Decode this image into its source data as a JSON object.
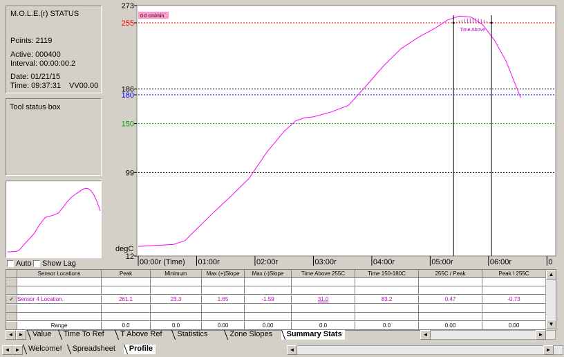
{
  "status": {
    "title": "M.O.L.E.(r) STATUS",
    "points": "Points: 2119",
    "active": "Active: 000400",
    "interval": "Interval: 00:00:00.2",
    "date": "Date: 01/21/15",
    "time": "Time: 09:37:31",
    "version": "VV00.00"
  },
  "tool_status": "Tool status box",
  "controls": {
    "auto_label": "Auto",
    "show_lag_label": "Show Lag"
  },
  "chart_data": {
    "type": "line",
    "badge": "0.0 cm/min",
    "ylabel": "degC",
    "ylim": [
      12,
      273
    ],
    "xlim_min": [
      0,
      6.6
    ],
    "y_ticks": [
      {
        "value": 273,
        "color": "#000000",
        "label": "273"
      },
      {
        "value": 255,
        "color": "#ff0000",
        "label": "255"
      },
      {
        "value": 186,
        "color": "#000000",
        "label": "186"
      },
      {
        "value": 180,
        "color": "#0000ff",
        "label": "180"
      },
      {
        "value": 150,
        "color": "#009900",
        "label": "150"
      },
      {
        "value": 99,
        "color": "#000000",
        "label": "99"
      },
      {
        "value": 12,
        "color": "#000000",
        "label": "12"
      }
    ],
    "ref_lines": [
      {
        "value": 255,
        "color": "#ff0000"
      },
      {
        "value": 186,
        "color": "#000000"
      },
      {
        "value": 180,
        "color": "#0000ff"
      },
      {
        "value": 150,
        "color": "#009900"
      },
      {
        "value": 99,
        "color": "#000000"
      }
    ],
    "x_ticks": [
      {
        "value": 0,
        "label": "00:00r (Time)"
      },
      {
        "value": 1,
        "label": "01:00r"
      },
      {
        "value": 2,
        "label": "02:00r"
      },
      {
        "value": 3,
        "label": "03:00r"
      },
      {
        "value": 4,
        "label": "04:00r"
      },
      {
        "value": 5,
        "label": "05:00r"
      },
      {
        "value": 6,
        "label": "06:00r"
      },
      {
        "value": 7,
        "label": "0"
      }
    ],
    "series": [
      {
        "color": "#ff00ff",
        "x": [
          0,
          0.3,
          0.6,
          0.8,
          1.0,
          1.3,
          1.6,
          1.9,
          2.2,
          2.5,
          2.7,
          2.85,
          3.0,
          3.3,
          3.6,
          3.9,
          4.2,
          4.5,
          4.8,
          5.1,
          5.3,
          5.5,
          5.7,
          5.9,
          6.1,
          6.3,
          6.55
        ],
        "y": [
          22,
          23,
          24,
          28,
          40,
          58,
          75,
          93,
          120,
          142,
          153,
          156,
          157,
          162,
          169,
          189,
          210,
          228,
          240,
          250,
          258,
          262,
          261,
          253,
          237,
          215,
          177
        ]
      }
    ],
    "time_above": {
      "label": "Time Above",
      "x_start": 5.4,
      "x_end": 6.05,
      "ref": 255
    }
  },
  "table": {
    "headers": [
      "Sensor Locations",
      "Peak",
      "Minimum",
      "Max (+)Slope",
      "Max (-)Slope",
      "Time Above 255C",
      "Time 150-180C",
      "255C / Peak",
      "Peak \\ 255C"
    ],
    "sensor_row": [
      "Sensor 4 Location.",
      "261.1",
      "23.3",
      "1.65",
      "-1.59",
      "31.0",
      "83.2",
      "0.47",
      "-0.73"
    ],
    "range_row": [
      "Range",
      "0.0",
      "0.0",
      "0.00",
      "0.00",
      "0.0",
      "0.0",
      "0.00",
      "0.00"
    ],
    "checked": "✓"
  },
  "tabs_bottom": [
    "Value",
    "Time To Ref",
    "T Above Ref",
    "Statistics",
    "Zone Slopes",
    "Summary Stats"
  ],
  "active_bottom": "Summary Stats",
  "tabs_window": [
    "Welcome!",
    "Spreadsheet",
    "Profile"
  ],
  "active_window": "Profile",
  "icons": {
    "left": "◄",
    "right": "►",
    "up": "▲",
    "down": "▼"
  }
}
